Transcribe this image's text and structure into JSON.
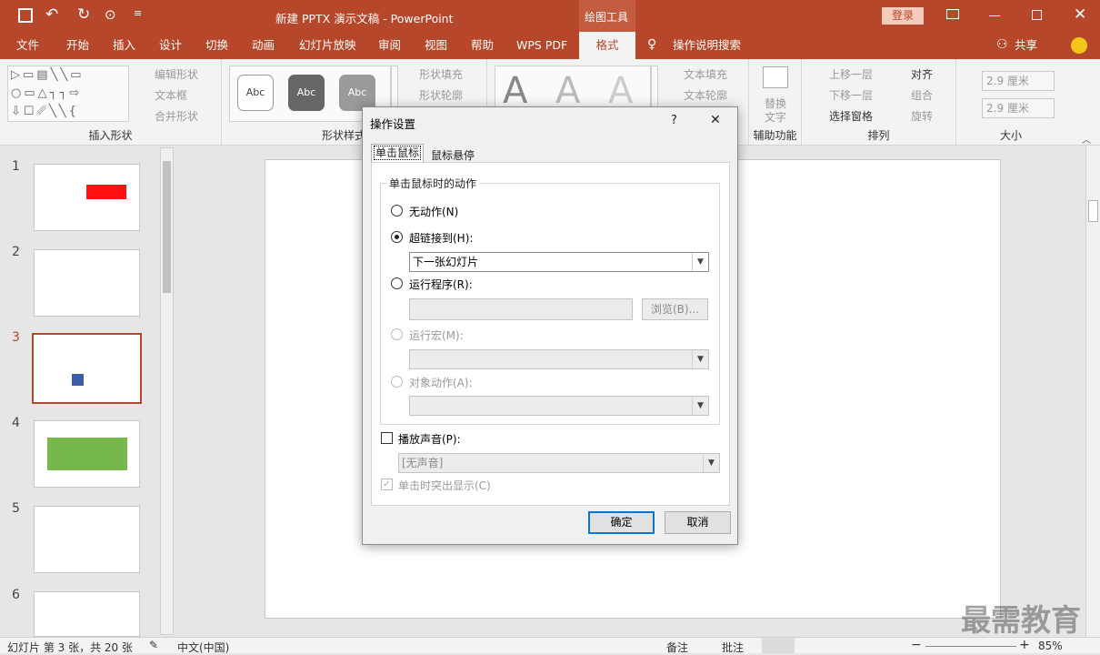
{
  "window": {
    "title": "新建 PPTX 演示文稿 - PowerPoint",
    "context_tab": "绘图工具",
    "login": "登录"
  },
  "tabs": [
    "文件",
    "开始",
    "插入",
    "设计",
    "切换",
    "动画",
    "幻灯片放映",
    "审阅",
    "视图",
    "帮助",
    "WPS PDF",
    "格式"
  ],
  "search_hint": "操作说明搜索",
  "share": "共享",
  "ribbon": {
    "insert_shapes": {
      "label": "插入形状",
      "edit_shape": "编辑形状",
      "textbox": "文本框",
      "merge": "合并形状"
    },
    "shape_styles": {
      "label": "形状样式",
      "sample": "Abc",
      "fill": "形状填充",
      "outline": "形状轮廓"
    },
    "wordart": {
      "sample": "A",
      "text_fill": "文本填充",
      "text_outline": "文本轮廓"
    },
    "accessibility": {
      "label": "辅助功能",
      "alt_text_1": "替换",
      "alt_text_2": "文字"
    },
    "arrange": {
      "label": "排列",
      "bring_forward": "上移一层",
      "send_backward": "下移一层",
      "selection_pane": "选择窗格",
      "align": "对齐",
      "group": "组合",
      "rotate": "旋转"
    },
    "size": {
      "label": "大小",
      "height": "2.9 厘米",
      "width": "2.9 厘米"
    }
  },
  "slides": [
    {
      "num": "1"
    },
    {
      "num": "2"
    },
    {
      "num": "3"
    },
    {
      "num": "4"
    },
    {
      "num": "5"
    },
    {
      "num": "6"
    }
  ],
  "dialog": {
    "title": "操作设置",
    "help": "?",
    "close": "✕",
    "tabs": [
      "单击鼠标",
      "鼠标悬停"
    ],
    "group_title": "单击鼠标时的动作",
    "opt_none": "无动作(N)",
    "opt_hyperlink": "超链接到(H):",
    "hyperlink_value": "下一张幻灯片",
    "opt_run_program": "运行程序(R):",
    "browse": "浏览(B)...",
    "opt_run_macro": "运行宏(M):",
    "opt_object_action": "对象动作(A):",
    "play_sound": "播放声音(P):",
    "sound_value": "[无声音]",
    "highlight_click": "单击时突出显示(C)",
    "ok": "确定",
    "cancel": "取消"
  },
  "status": {
    "slide_info": "幻灯片 第 3 张，共 20 张",
    "language": "中文(中国)",
    "notes": "备注",
    "comments": "批注",
    "zoom": "85%"
  },
  "watermark": "最需教育",
  "colors": {
    "accent": "#b7472a",
    "selected_border": "#b7472a"
  }
}
